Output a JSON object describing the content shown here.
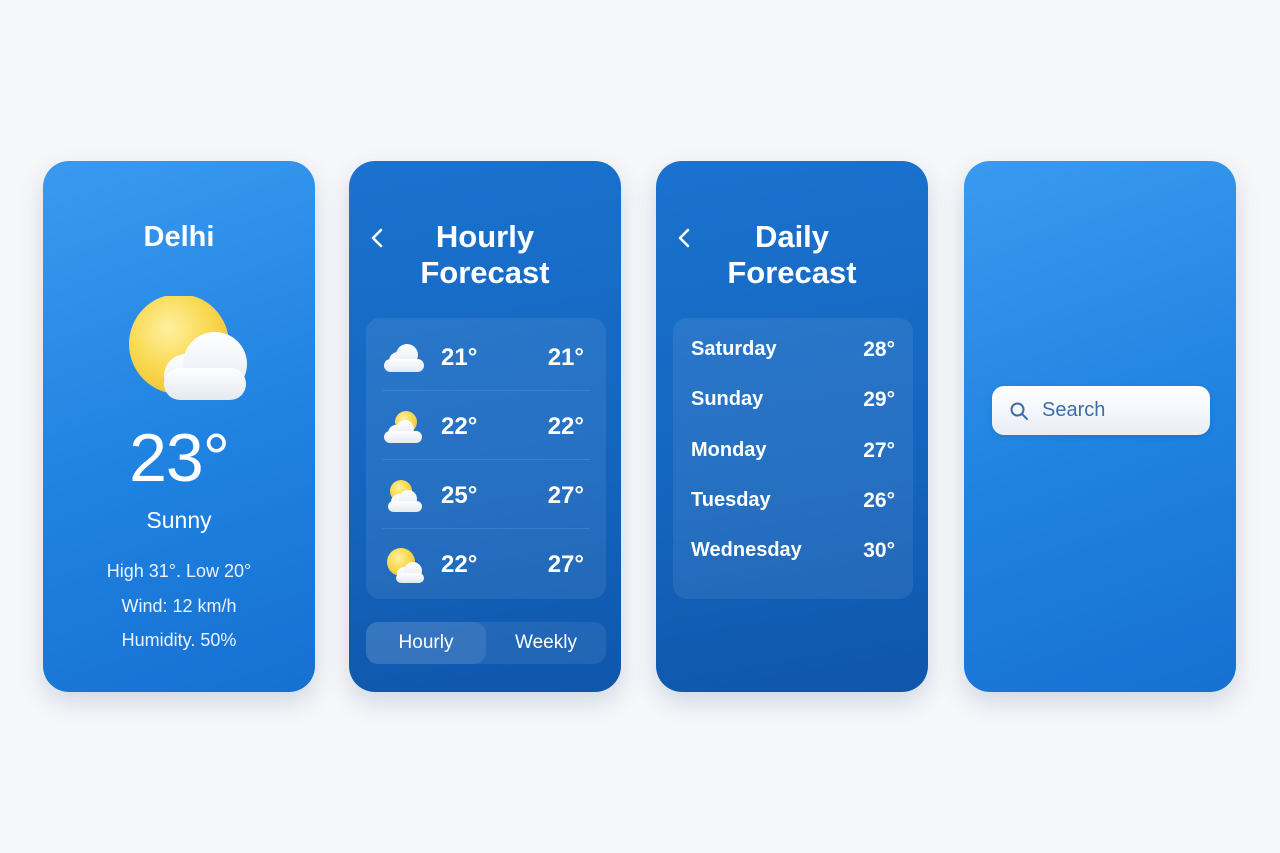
{
  "screen_current": {
    "city": "Delhi",
    "icon": "sun-behind-cloud-icon",
    "temperature": "23°",
    "condition": "Sunny",
    "high_low": "High 31°. Low 20°",
    "wind": "Wind: 12 km/h",
    "humidity": "Humidity. 50%"
  },
  "screen_hourly": {
    "back_icon": "chevron-left-icon",
    "title_line1": "Hourly",
    "title_line2": "Forecast",
    "rows": [
      {
        "icon": "cloud-icon",
        "temp1": "21°",
        "temp2": "21°"
      },
      {
        "icon": "partly-cloudy-icon",
        "temp1": "22°",
        "temp2": "22°"
      },
      {
        "icon": "partly-cloudy-icon",
        "temp1": "25°",
        "temp2": "27°"
      },
      {
        "icon": "sun-behind-cloud-icon",
        "temp1": "22°",
        "temp2": "27°"
      }
    ],
    "tabs": {
      "hourly": "Hourly",
      "weekly": "Weekly",
      "selected": "Hourly"
    }
  },
  "screen_daily": {
    "back_icon": "chevron-left-icon",
    "title_line1": "Daily",
    "title_line2": "Forecast",
    "rows": [
      {
        "day": "Saturday",
        "temp": "28°"
      },
      {
        "day": "Sunday",
        "temp": "29°"
      },
      {
        "day": "Monday",
        "temp": "27°"
      },
      {
        "day": "Tuesday",
        "temp": "26°"
      },
      {
        "day": "Wednesday",
        "temp": "30°"
      }
    ]
  },
  "screen_search": {
    "search_icon": "search-icon",
    "placeholder": "Search"
  },
  "colors": {
    "light_blue": "#2a8ce8",
    "dark_blue": "#1464bd",
    "sun_yellow": "#f7d54a",
    "cloud_white": "#ffffff",
    "search_text": "#3b6ea8"
  }
}
